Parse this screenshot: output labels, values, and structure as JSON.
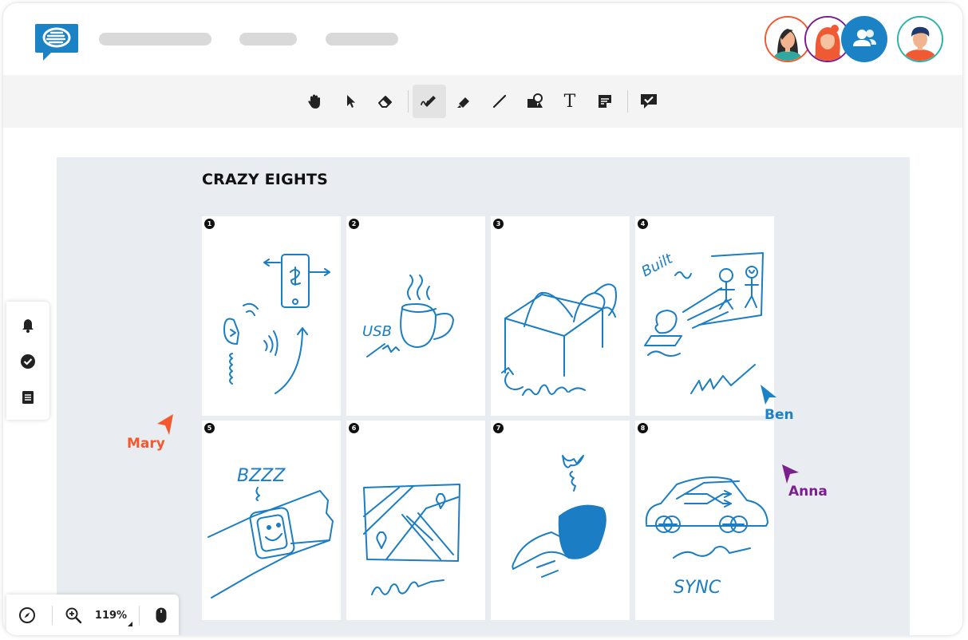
{
  "colors": {
    "brand": "#1b82c5",
    "ink": "#1b7dc4",
    "mary": "#f4582d",
    "ben": "#1b82c5",
    "anna": "#7b1f90"
  },
  "header": {
    "logo_icon": "chat-bubble-logo-icon",
    "nav_placeholders": 3,
    "collaborators": [
      {
        "name": "collaborator-avatar-1",
        "ring": "#f4582d"
      },
      {
        "name": "collaborator-avatar-2",
        "ring": "#7b1f90"
      },
      {
        "name": "collaborators-button",
        "icon": "users-icon"
      },
      {
        "name": "current-user-avatar",
        "ring": "#2bb3a8"
      }
    ]
  },
  "toolbar": {
    "tools": [
      {
        "id": "hand",
        "icon": "hand-icon"
      },
      {
        "id": "select",
        "icon": "pointer-icon"
      },
      {
        "id": "eraser",
        "icon": "eraser-icon"
      },
      {
        "id": "pen",
        "icon": "pen-icon",
        "active": true
      },
      {
        "id": "highlighter",
        "icon": "highlighter-icon"
      },
      {
        "id": "line",
        "icon": "line-icon"
      },
      {
        "id": "shapes",
        "icon": "shapes-icon"
      },
      {
        "id": "text",
        "icon": "text-icon",
        "glyph": "T"
      },
      {
        "id": "sticky-note",
        "icon": "sticky-note-icon"
      },
      {
        "id": "comment",
        "icon": "comment-check-icon"
      }
    ]
  },
  "board": {
    "title": "CRAZY EIGHTS",
    "cards": [
      {
        "number": "1",
        "sketch_label": ""
      },
      {
        "number": "2",
        "sketch_label": "USB"
      },
      {
        "number": "3",
        "sketch_label": ""
      },
      {
        "number": "4",
        "sketch_label": "Built"
      },
      {
        "number": "5",
        "sketch_label": "BZZZ"
      },
      {
        "number": "6",
        "sketch_label": ""
      },
      {
        "number": "7",
        "sketch_label": ""
      },
      {
        "number": "8",
        "sketch_label": "SYNC"
      }
    ]
  },
  "cursors": [
    {
      "name": "Mary",
      "color": "#f4582d"
    },
    {
      "name": "Ben",
      "color": "#1b82c5"
    },
    {
      "name": "Anna",
      "color": "#7b1f90"
    }
  ],
  "sidepanel": {
    "items": [
      {
        "id": "notifications",
        "icon": "bell-icon"
      },
      {
        "id": "tasks",
        "icon": "check-circle-icon"
      },
      {
        "id": "list",
        "icon": "list-icon"
      }
    ]
  },
  "zoombar": {
    "zoom_level": "119%",
    "icons": [
      "compass-icon",
      "zoom-in-icon",
      "mouse-icon"
    ]
  }
}
